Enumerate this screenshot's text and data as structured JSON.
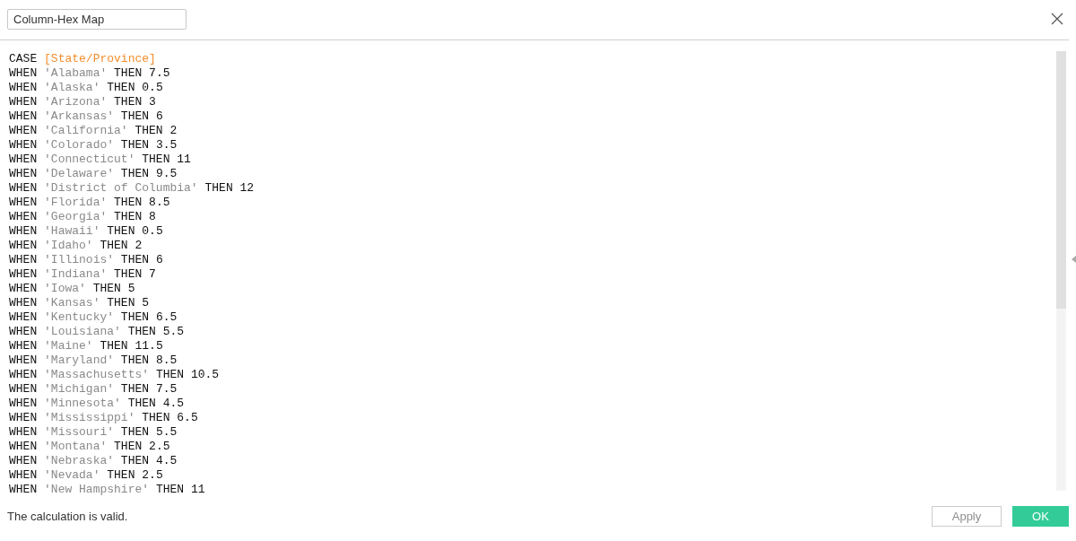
{
  "name_field": {
    "value": "Column-Hex Map"
  },
  "formula": [
    {
      "kind": "case",
      "keyword": "CASE",
      "field": "[State/Province]"
    },
    {
      "kind": "when",
      "keyword": "WHEN",
      "state": "'Alabama'",
      "then": "THEN",
      "value": "7.5"
    },
    {
      "kind": "when",
      "keyword": "WHEN",
      "state": "'Alaska'",
      "then": "THEN",
      "value": "0.5"
    },
    {
      "kind": "when",
      "keyword": "WHEN",
      "state": "'Arizona'",
      "then": "THEN",
      "value": "3"
    },
    {
      "kind": "when",
      "keyword": "WHEN",
      "state": "'Arkansas'",
      "then": "THEN",
      "value": "6"
    },
    {
      "kind": "when",
      "keyword": "WHEN",
      "state": "'California'",
      "then": "THEN",
      "value": "2"
    },
    {
      "kind": "when",
      "keyword": "WHEN",
      "state": "'Colorado'",
      "then": "THEN",
      "value": "3.5"
    },
    {
      "kind": "when",
      "keyword": "WHEN",
      "state": "'Connecticut'",
      "then": "THEN",
      "value": "11"
    },
    {
      "kind": "when",
      "keyword": "WHEN",
      "state": "'Delaware'",
      "then": "THEN",
      "value": "9.5"
    },
    {
      "kind": "when",
      "keyword": "WHEN",
      "state": "'District of Columbia'",
      "then": "THEN",
      "value": "12"
    },
    {
      "kind": "when",
      "keyword": "WHEN",
      "state": "'Florida'",
      "then": "THEN",
      "value": "8.5"
    },
    {
      "kind": "when",
      "keyword": "WHEN",
      "state": "'Georgia'",
      "then": "THEN",
      "value": "8"
    },
    {
      "kind": "when",
      "keyword": "WHEN",
      "state": "'Hawaii'",
      "then": "THEN",
      "value": "0.5"
    },
    {
      "kind": "when",
      "keyword": "WHEN",
      "state": "'Idaho'",
      "then": "THEN",
      "value": "2"
    },
    {
      "kind": "when",
      "keyword": "WHEN",
      "state": "'Illinois'",
      "then": "THEN",
      "value": "6"
    },
    {
      "kind": "when",
      "keyword": "WHEN",
      "state": "'Indiana'",
      "then": "THEN",
      "value": "7"
    },
    {
      "kind": "when",
      "keyword": "WHEN",
      "state": "'Iowa'",
      "then": "THEN",
      "value": "5"
    },
    {
      "kind": "when",
      "keyword": "WHEN",
      "state": "'Kansas'",
      "then": "THEN",
      "value": "5"
    },
    {
      "kind": "when",
      "keyword": "WHEN",
      "state": "'Kentucky'",
      "then": "THEN",
      "value": "6.5"
    },
    {
      "kind": "when",
      "keyword": "WHEN",
      "state": "'Louisiana'",
      "then": "THEN",
      "value": "5.5"
    },
    {
      "kind": "when",
      "keyword": "WHEN",
      "state": "'Maine'",
      "then": "THEN",
      "value": "11.5"
    },
    {
      "kind": "when",
      "keyword": "WHEN",
      "state": "'Maryland'",
      "then": "THEN",
      "value": "8.5"
    },
    {
      "kind": "when",
      "keyword": "WHEN",
      "state": "'Massachusetts'",
      "then": "THEN",
      "value": "10.5"
    },
    {
      "kind": "when",
      "keyword": "WHEN",
      "state": "'Michigan'",
      "then": "THEN",
      "value": "7.5"
    },
    {
      "kind": "when",
      "keyword": "WHEN",
      "state": "'Minnesota'",
      "then": "THEN",
      "value": "4.5"
    },
    {
      "kind": "when",
      "keyword": "WHEN",
      "state": "'Mississippi'",
      "then": "THEN",
      "value": "6.5"
    },
    {
      "kind": "when",
      "keyword": "WHEN",
      "state": "'Missouri'",
      "then": "THEN",
      "value": "5.5"
    },
    {
      "kind": "when",
      "keyword": "WHEN",
      "state": "'Montana'",
      "then": "THEN",
      "value": "2.5"
    },
    {
      "kind": "when",
      "keyword": "WHEN",
      "state": "'Nebraska'",
      "then": "THEN",
      "value": "4.5"
    },
    {
      "kind": "when",
      "keyword": "WHEN",
      "state": "'Nevada'",
      "then": "THEN",
      "value": "2.5"
    },
    {
      "kind": "when",
      "keyword": "WHEN",
      "state": "'New Hampshire'",
      "then": "THEN",
      "value": "11"
    }
  ],
  "status": "The calculation is valid.",
  "buttons": [
    {
      "kind": "secondary",
      "label": "Apply",
      "disabled": true
    },
    {
      "kind": "primary",
      "label": "OK",
      "disabled": false
    }
  ]
}
